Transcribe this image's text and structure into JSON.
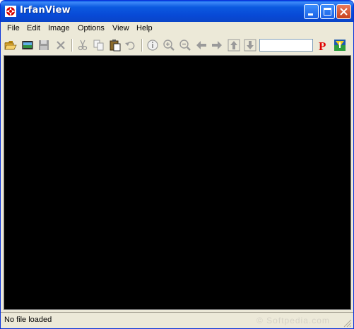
{
  "window": {
    "title": "IrfanView"
  },
  "menu": {
    "items": [
      "File",
      "Edit",
      "Image",
      "Options",
      "View",
      "Help"
    ]
  },
  "toolbar": {
    "buttons": [
      "open-folder-icon",
      "slideshow-icon",
      "save-icon",
      "delete-icon",
      "cut-icon",
      "copy-icon",
      "paste-icon",
      "undo-icon",
      "info-icon",
      "zoom-in-icon",
      "zoom-out-icon",
      "previous-icon",
      "next-icon",
      "first-icon",
      "last-icon",
      "print-icon",
      "logo-icon"
    ],
    "search_value": "",
    "p_label": "P"
  },
  "status": {
    "text": "No file loaded",
    "watermark": "© Softpedia.com"
  },
  "colors": {
    "title_bar": "#0a5ae8",
    "canvas": "#000000",
    "chrome": "#ece9d8",
    "p_red": "#e00000"
  }
}
